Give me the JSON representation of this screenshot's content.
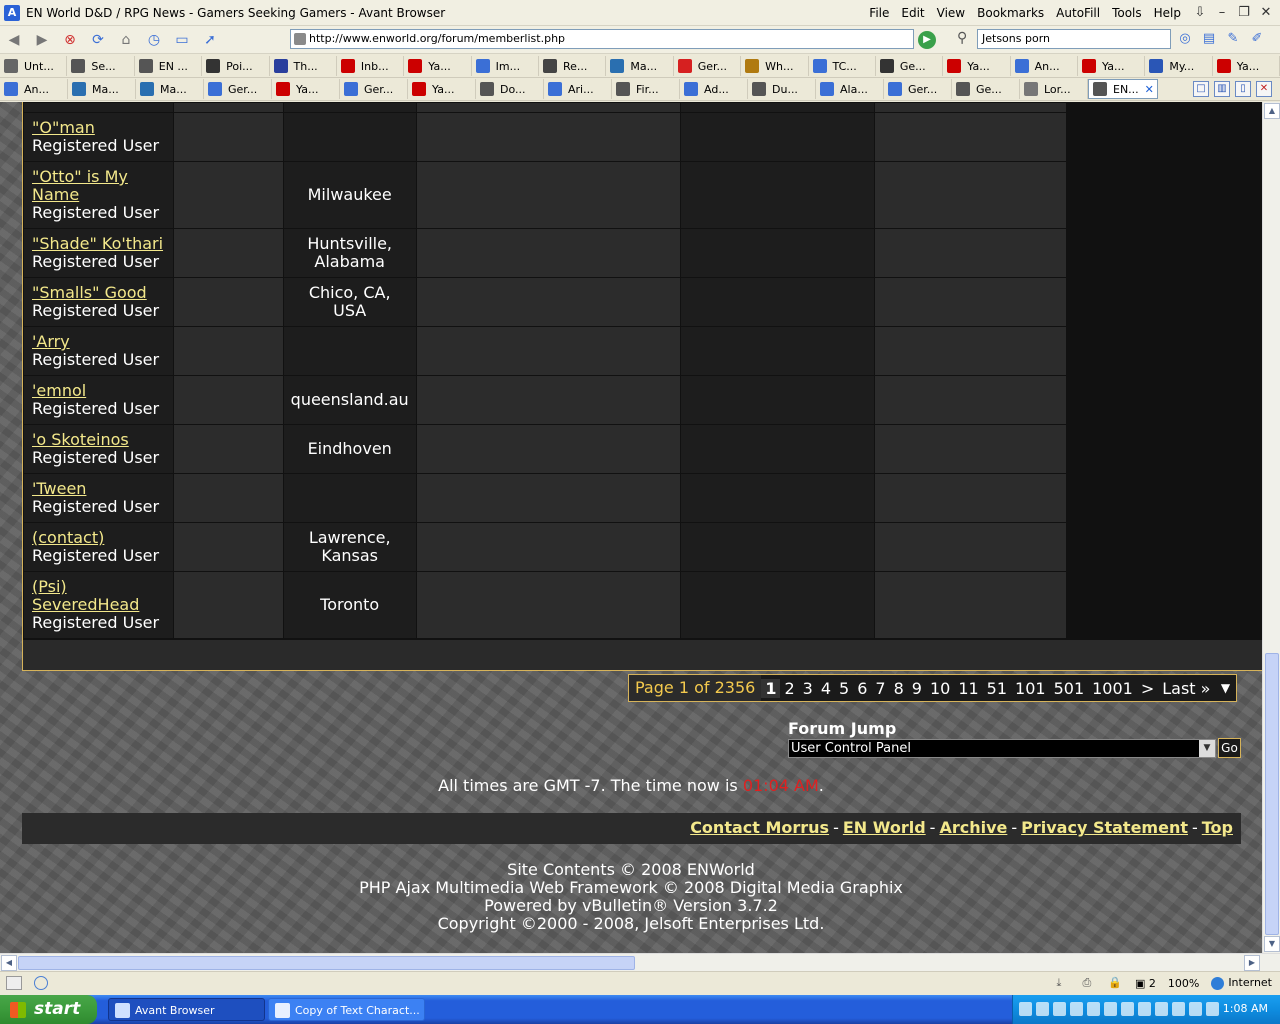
{
  "window": {
    "title": "EN World D&D / RPG News - Gamers Seeking Gamers - Avant Browser",
    "menu": [
      "File",
      "Edit",
      "View",
      "Bookmarks",
      "AutoFill",
      "Tools",
      "Help"
    ]
  },
  "navbar": {
    "address": "http://www.enworld.org/forum/memberlist.php",
    "search_value": "Jetsons porn"
  },
  "tabs_row1": [
    {
      "label": "Unt...",
      "icon_color": "#666666"
    },
    {
      "label": "Se...",
      "icon_color": "#555555"
    },
    {
      "label": "EN ...",
      "icon_color": "#555555"
    },
    {
      "label": "Poi...",
      "icon_color": "#333333"
    },
    {
      "label": "Th...",
      "icon_color": "#2a3f9d"
    },
    {
      "label": "Inb...",
      "icon_color": "#cc0000"
    },
    {
      "label": "Ya...",
      "icon_color": "#cc0000"
    },
    {
      "label": "Im...",
      "icon_color": "#3b6fd6"
    },
    {
      "label": "Re...",
      "icon_color": "#444444"
    },
    {
      "label": "Ma...",
      "icon_color": "#2a6fb0"
    },
    {
      "label": "Ger...",
      "icon_color": "#d62020"
    },
    {
      "label": "Wh...",
      "icon_color": "#b07a10"
    },
    {
      "label": "TC...",
      "icon_color": "#3b6fd6"
    },
    {
      "label": "Ge...",
      "icon_color": "#333333"
    },
    {
      "label": "Ya...",
      "icon_color": "#cc0000"
    },
    {
      "label": "An...",
      "icon_color": "#3b6fd6"
    },
    {
      "label": "Ya...",
      "icon_color": "#cc0000"
    },
    {
      "label": "My...",
      "icon_color": "#2a56b6"
    },
    {
      "label": "Ya...",
      "icon_color": "#cc0000"
    }
  ],
  "tabs_row2": [
    {
      "label": "An...",
      "icon_color": "#3b6fd6",
      "active": false
    },
    {
      "label": "Ma...",
      "icon_color": "#2a6fb0",
      "active": false
    },
    {
      "label": "Ma...",
      "icon_color": "#2a6fb0",
      "active": false
    },
    {
      "label": "Ger...",
      "icon_color": "#3b6fd6",
      "active": false
    },
    {
      "label": "Ya...",
      "icon_color": "#cc0000",
      "active": false
    },
    {
      "label": "Ger...",
      "icon_color": "#3b6fd6",
      "active": false
    },
    {
      "label": "Ya...",
      "icon_color": "#cc0000",
      "active": false
    },
    {
      "label": "Do...",
      "icon_color": "#555555",
      "active": false
    },
    {
      "label": "Ari...",
      "icon_color": "#3b6fd6",
      "active": false
    },
    {
      "label": "Fir...",
      "icon_color": "#555555",
      "active": false
    },
    {
      "label": "Ad...",
      "icon_color": "#3b6fd6",
      "active": false
    },
    {
      "label": "Du...",
      "icon_color": "#555555",
      "active": false
    },
    {
      "label": "Ala...",
      "icon_color": "#3b6fd6",
      "active": false
    },
    {
      "label": "Ger...",
      "icon_color": "#3b6fd6",
      "active": false
    },
    {
      "label": "Ge...",
      "icon_color": "#555555",
      "active": false
    },
    {
      "label": "Lor...",
      "icon_color": "#777777",
      "active": false
    },
    {
      "label": "EN...",
      "icon_color": "#555555",
      "active": true
    }
  ],
  "members": [
    {
      "name_lines": [
        "\"O\"man"
      ],
      "role": "Registered User",
      "location_lines": []
    },
    {
      "name_lines": [
        "\"Otto\" is My",
        "Name"
      ],
      "role": "Registered User",
      "location_lines": [
        "Milwaukee"
      ]
    },
    {
      "name_lines": [
        "\"Shade\" Ko'thari"
      ],
      "role": "Registered User",
      "location_lines": [
        "Huntsville,",
        "Alabama"
      ]
    },
    {
      "name_lines": [
        "\"Smalls\" Good"
      ],
      "role": "Registered User",
      "location_lines": [
        "Chico, CA,",
        "USA"
      ]
    },
    {
      "name_lines": [
        "'Arry"
      ],
      "role": "Registered User",
      "location_lines": []
    },
    {
      "name_lines": [
        "'emnol"
      ],
      "role": "Registered User",
      "location_lines": [
        "queensland.au"
      ]
    },
    {
      "name_lines": [
        "'o Skoteinos"
      ],
      "role": "Registered User",
      "location_lines": [
        "Eindhoven"
      ]
    },
    {
      "name_lines": [
        "'Tween"
      ],
      "role": "Registered User",
      "location_lines": []
    },
    {
      "name_lines": [
        "(contact)"
      ],
      "role": "Registered User",
      "location_lines": [
        "Lawrence,",
        "Kansas"
      ]
    },
    {
      "name_lines": [
        "(Psi)",
        "SeveredHead"
      ],
      "role": "Registered User",
      "location_lines": [
        "Toronto"
      ]
    }
  ],
  "pagenav": {
    "label": "Page 1 of 2356",
    "pages": [
      "1",
      "2",
      "3",
      "4",
      "5",
      "6",
      "7",
      "8",
      "9",
      "10",
      "11",
      "51",
      "101",
      "501",
      "1001",
      ">",
      "Last »"
    ],
    "current": "1"
  },
  "forum_jump": {
    "label": "Forum Jump",
    "selected": "User Control Panel",
    "go_label": "Go"
  },
  "time_line": {
    "prefix": "All times are GMT -7. The time now is ",
    "time": "01:04 AM",
    "suffix": "."
  },
  "footer_links": [
    "Contact Morrus",
    "EN World",
    "Archive",
    "Privacy Statement",
    "Top"
  ],
  "copyright": [
    "Site Contents © 2008 ENWorld",
    "PHP Ajax Multimedia Web Framework © 2008 Digital Media Graphix",
    "Powered by vBulletin® Version 3.7.2",
    "Copyright ©2000 - 2008, Jelsoft Enterprises Ltd."
  ],
  "statusbar": {
    "tab_count": "2",
    "zoom": "100%",
    "zone": "Internet"
  },
  "taskbar": {
    "start_label": "start",
    "tasks": [
      "Avant Browser",
      "Copy of Text Charact..."
    ],
    "clock": "1:08 AM"
  }
}
